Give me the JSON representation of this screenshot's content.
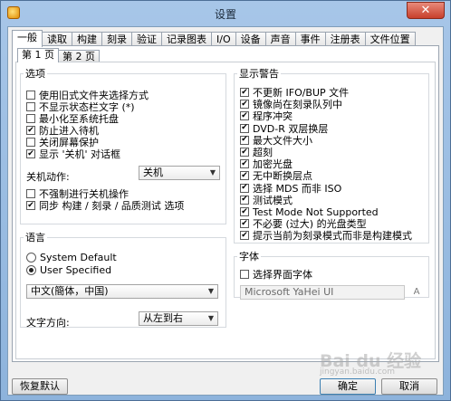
{
  "window": {
    "title": "设置",
    "close_glyph": "✕"
  },
  "tabs": [
    "一般",
    "读取",
    "构建",
    "刻录",
    "验证",
    "记录图表",
    "I/O",
    "设备",
    "声音",
    "事件",
    "注册表",
    "文件位置"
  ],
  "subtabs": [
    "第 1 页",
    "第 2 页"
  ],
  "options_group": {
    "legend": "选项",
    "items": [
      {
        "label": "使用旧式文件夹选择方式",
        "checked": false
      },
      {
        "label": "不显示状态栏文字 (*)",
        "checked": false
      },
      {
        "label": "最小化至系统托盘",
        "checked": false
      },
      {
        "label": "防止进入待机",
        "checked": true
      },
      {
        "label": "关闭屏幕保护",
        "checked": false
      },
      {
        "label": "显示 '关机' 对话框",
        "checked": true
      }
    ],
    "shutdown_label": "关机动作:",
    "shutdown_value": "关机",
    "force_shutdown": {
      "label": "不强制进行关机操作",
      "checked": false
    },
    "sync_test": {
      "label": "同步 构建 / 刻录 / 品质测试 选项",
      "checked": true
    }
  },
  "language_group": {
    "legend": "语言",
    "radios": [
      {
        "label": "System Default",
        "selected": false
      },
      {
        "label": "User Specified",
        "selected": true
      }
    ],
    "language_value": "中文(簡体，中国)",
    "direction_label": "文字方向:",
    "direction_value": "从左到右"
  },
  "warnings_group": {
    "legend": "显示警告",
    "items": [
      {
        "label": "不更新 IFO/BUP 文件",
        "checked": true
      },
      {
        "label": "镜像尚在刻录队列中",
        "checked": true
      },
      {
        "label": "程序冲突",
        "checked": true
      },
      {
        "label": "DVD-R 双层换层",
        "checked": true
      },
      {
        "label": "最大文件大小",
        "checked": true
      },
      {
        "label": "超刻",
        "checked": true
      },
      {
        "label": "加密光盘",
        "checked": true
      },
      {
        "label": "无中断换层点",
        "checked": true
      },
      {
        "label": "选择 MDS 而非 ISO",
        "checked": true
      },
      {
        "label": "测试模式",
        "checked": true
      },
      {
        "label": "Test Mode Not Supported",
        "checked": true
      },
      {
        "label": "不必要 (过大) 的光盘类型",
        "checked": true
      },
      {
        "label": "提示当前为刻录模式而非是构建模式",
        "checked": true
      }
    ]
  },
  "font_group": {
    "legend": "字体",
    "select_font": {
      "label": "选择界面字体",
      "checked": false
    },
    "font_value": "Microsoft YaHei UI",
    "font_button": "A"
  },
  "buttons": {
    "restore": "恢复默认",
    "ok": "确定",
    "cancel": "取消"
  },
  "watermark": {
    "brand": "Bai du 经验",
    "url": "jingyan.baidu.com"
  },
  "check_glyph": "✔",
  "arrow_glyph": "▼"
}
